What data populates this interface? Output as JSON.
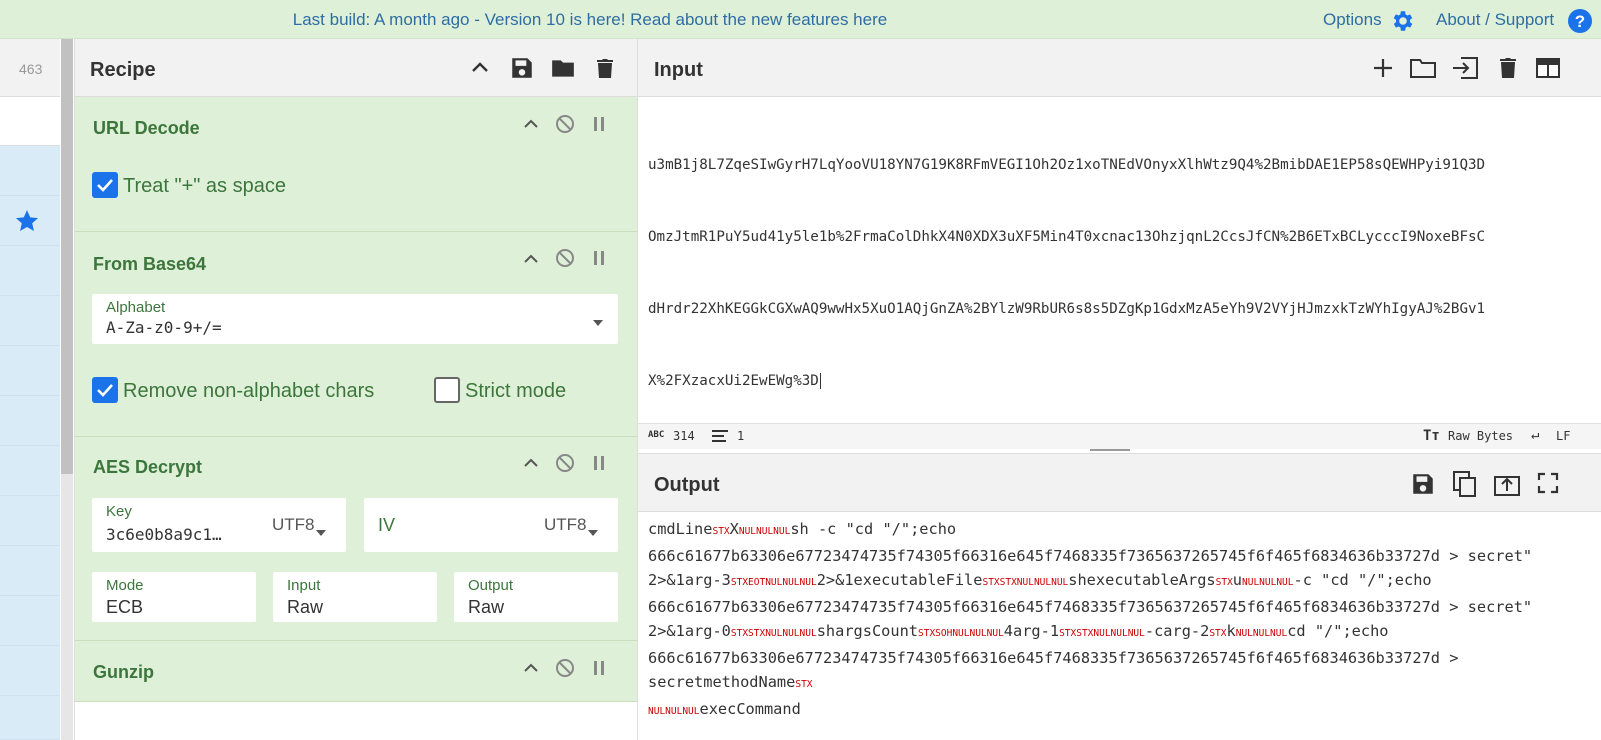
{
  "banner": {
    "message": "Last build: A month ago - Version 10 is here! Read about the new features here",
    "options_label": "Options",
    "about_label": "About / Support"
  },
  "operations_list": {
    "count": "463"
  },
  "recipe": {
    "title": "Recipe",
    "operations": [
      {
        "title": "URL Decode",
        "checkbox_label": "Treat \"+\" as space",
        "checkbox_checked": true
      },
      {
        "title": "From Base64",
        "alphabet_label": "Alphabet",
        "alphabet_value": "A-Za-z0-9+/=",
        "remove_label": "Remove non-alphabet chars",
        "remove_checked": true,
        "strict_label": "Strict mode",
        "strict_checked": false
      },
      {
        "title": "AES Decrypt",
        "key_label": "Key",
        "key_value": "3c6e0b8a9c1…",
        "key_encoding": "UTF8",
        "iv_label": "IV",
        "iv_encoding": "UTF8",
        "mode_label": "Mode",
        "mode_value": "ECB",
        "input_label": "Input",
        "input_value": "Raw",
        "output_label": "Output",
        "output_value": "Raw"
      },
      {
        "title": "Gunzip"
      }
    ]
  },
  "input": {
    "title": "Input",
    "lines": [
      "u3mB1j8L7ZqeSIwGyrH7LqYooVU18YN7G19K8RFmVEGI1Oh2Oz1xoTNEdVOnyxXlhWtz9Q4%2BmibDAE1EP58sQEWHPyi91Q3D",
      "OmzJtmR1PuY5ud41y5le1b%2FrmaColDhkX4N0XDX3uXF5Min4T0xcnac13OhzjqnL2CcsJfCN%2B6ETxBCLycccI9NoxeBFsC",
      "dHrdr22XhKEGGkCGXwAQ9wwHx5XuO1AQjGnZA%2BYlzW9RbUR6s8s5DZgKp1GdxMzA5eYh9V2VYjHJmzxkTzWYhIgyAJ%2BGv1",
      "X%2FXzacxUi2EwEWg%3D"
    ],
    "char_count": "314",
    "line_count": "1",
    "encoding": "Raw Bytes",
    "eol": "LF"
  },
  "output": {
    "title": "Output",
    "lines": [
      [
        {
          "t": "cmdLine"
        },
        {
          "c": "STX"
        },
        {
          "t": "X"
        },
        {
          "c": "NULNULNUL"
        },
        {
          "t": "sh -c \"cd \"/\";echo"
        }
      ],
      [
        {
          "t": "666c61677b63306e67723474735f74305f66316e645f7468335f7365637265745f6f465f6834636b33727d > secret\""
        }
      ],
      [
        {
          "t": "2>&1arg-3"
        },
        {
          "c": "STXEOTNULNULNUL"
        },
        {
          "t": "2>&1executableFile"
        },
        {
          "c": "STXSTXNULNULNUL"
        },
        {
          "t": "shexecutableArgs"
        },
        {
          "c": "STX"
        },
        {
          "t": "u"
        },
        {
          "c": "NULNULNUL"
        },
        {
          "t": "-c \"cd \"/\";echo"
        }
      ],
      [
        {
          "t": "666c61677b63306e67723474735f74305f66316e645f7468335f7365637265745f6f465f6834636b33727d > secret\""
        }
      ],
      [
        {
          "t": "2>&1arg-0"
        },
        {
          "c": "STXSTXNULNULNUL"
        },
        {
          "t": "shargsCount"
        },
        {
          "c": "STXSOHNULNULNUL"
        },
        {
          "t": "4arg-1"
        },
        {
          "c": "STXSTXNULNULNUL"
        },
        {
          "t": "-carg-2"
        },
        {
          "c": "STX"
        },
        {
          "t": "k"
        },
        {
          "c": "NULNULNUL"
        },
        {
          "t": "cd \"/\";echo"
        }
      ],
      [
        {
          "t": "666c61677b63306e67723474735f74305f66316e645f7468335f7365637265745f6f465f6834636b33727d >"
        }
      ],
      [
        {
          "t": "secretmethodName"
        },
        {
          "c": "STX"
        }
      ],
      [
        {
          "c": "NULNULNUL"
        },
        {
          "t": "execCommand"
        }
      ]
    ]
  },
  "colors": {
    "banner_bg": "#dff0d8",
    "op_bg": "#dff0d8",
    "op_text": "#3c763d",
    "link": "#2e6da4",
    "checkbox": "#1a73e8",
    "control_char": "#cc0000",
    "ops_sidebar": "#d9ebf7"
  },
  "icons": {
    "banner": [
      "gear-icon",
      "help-icon"
    ],
    "recipe_header": [
      "chevron-up-icon",
      "save-icon",
      "folder-icon",
      "trash-icon"
    ],
    "op_controls": [
      "chevron-up-icon",
      "disable-icon",
      "pause-icon"
    ],
    "input_header": [
      "plus-icon",
      "folder-icon",
      "import-icon",
      "trash-icon",
      "layout-icon"
    ],
    "output_header": [
      "save-icon",
      "copy-icon",
      "replace-input-icon",
      "maximize-icon"
    ],
    "sidebar": [
      "star-icon"
    ]
  }
}
